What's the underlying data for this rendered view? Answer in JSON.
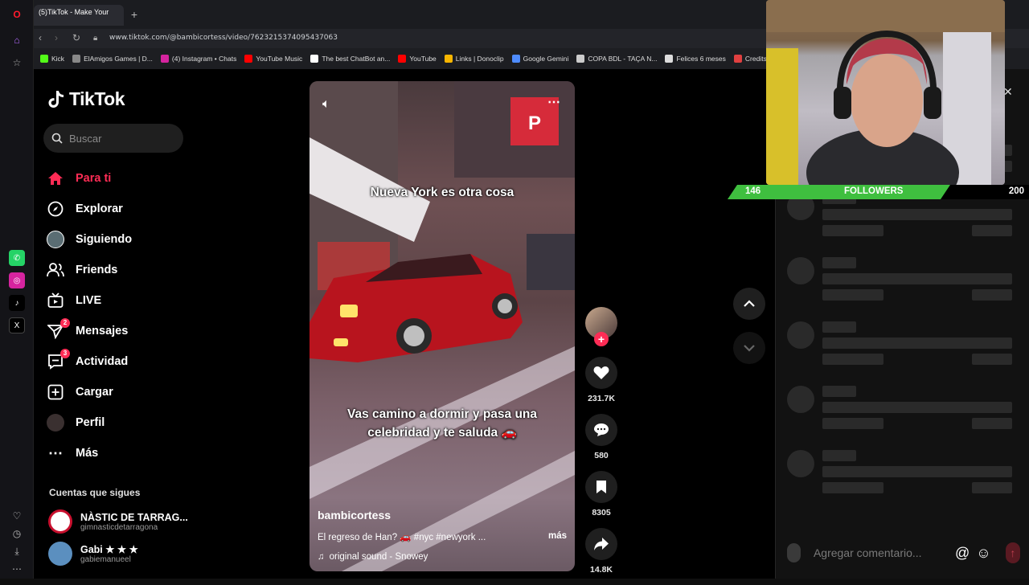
{
  "browser": {
    "tab_title": "(5)TikTok - Make Your",
    "url": "www.tiktok.com/@bambicortess/video/7623215374095437063",
    "bookmarks": [
      {
        "label": "Kick",
        "color": "#53fc18"
      },
      {
        "label": "ElAmigos Games | D...",
        "color": "#888888"
      },
      {
        "label": "(4) Instagram • Chats",
        "color": "#d6249f"
      },
      {
        "label": "YouTube Music",
        "color": "#ff0000"
      },
      {
        "label": "The best ChatBot an...",
        "color": "#ffffff"
      },
      {
        "label": "YouTube",
        "color": "#ff0000"
      },
      {
        "label": "Links | Donoclip",
        "color": "#f7b500"
      },
      {
        "label": "Google Gemini",
        "color": "#4e8cff"
      },
      {
        "label": "COPA BDL - TAÇA N...",
        "color": "#cccccc"
      },
      {
        "label": "Felices 6 meses",
        "color": "#dddddd"
      },
      {
        "label": "Credits - AxentHost",
        "color": "#e04040"
      }
    ]
  },
  "tiktok": {
    "logo": "TikTok",
    "search_placeholder": "Buscar",
    "nav": [
      {
        "label": "Para ti",
        "icon": "home-icon",
        "active": true,
        "badge": ""
      },
      {
        "label": "Explorar",
        "icon": "compass-icon",
        "active": false,
        "badge": ""
      },
      {
        "label": "Siguiendo",
        "icon": "following-avatar-icon",
        "active": false,
        "badge": ""
      },
      {
        "label": "Friends",
        "icon": "friends-icon",
        "active": false,
        "badge": ""
      },
      {
        "label": "LIVE",
        "icon": "live-tv-icon",
        "active": false,
        "badge": ""
      },
      {
        "label": "Mensajes",
        "icon": "send-icon",
        "active": false,
        "badge": "2"
      },
      {
        "label": "Actividad",
        "icon": "activity-icon",
        "active": false,
        "badge": "3"
      },
      {
        "label": "Cargar",
        "icon": "upload-plus-icon",
        "active": false,
        "badge": ""
      },
      {
        "label": "Perfil",
        "icon": "profile-avatar-icon",
        "active": false,
        "badge": ""
      },
      {
        "label": "Más",
        "icon": "more-dots-icon",
        "active": false,
        "badge": ""
      }
    ],
    "following_title": "Cuentas que sigues",
    "accounts": [
      {
        "name": "NÀSTIC DE TARRAG...",
        "handle": "gimnasticdetarragona",
        "color": "#c8102e"
      },
      {
        "name": "Gabi ★ ★ ★",
        "handle": "gabiemanueel",
        "color": "#2e6fa3"
      }
    ]
  },
  "video": {
    "caption_top": "Nueva York es otra cosa",
    "caption_mid_line1": "Vas camino a dormir y pasa una",
    "caption_mid_line2": "celebridad y te saluda 🚗",
    "author": "bambicortess",
    "description": "El regreso de Han? 🚗 #nyc #newyork ...",
    "more_label": "más",
    "sound": "original sound - Snowey",
    "likes": "231.7K",
    "comments": "580",
    "saves": "8305",
    "shares": "14.8K"
  },
  "comments_panel": {
    "input_placeholder": "Agregar comentario..."
  },
  "stream": {
    "followers_label": "FOLLOWERS",
    "followers_current": "146",
    "followers_goal": "200",
    "followers_progress": 0.73
  }
}
